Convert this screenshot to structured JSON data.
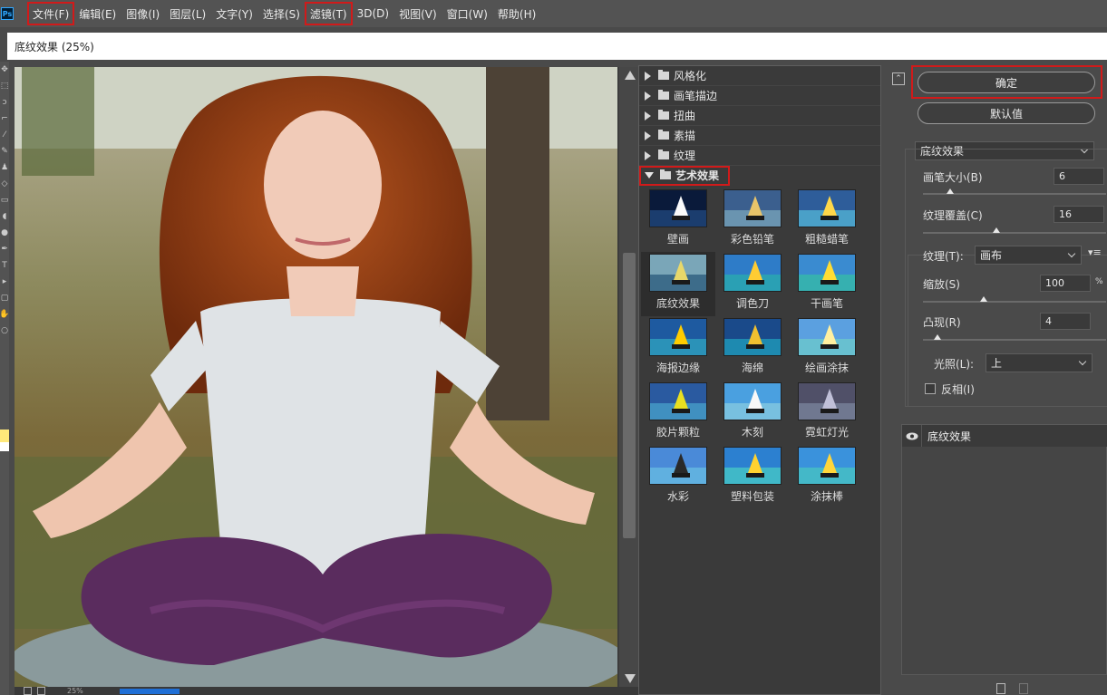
{
  "app": {
    "logo": "Ps"
  },
  "menu": [
    {
      "label": "文件(F)",
      "highlighted": true
    },
    {
      "label": "编辑(E)",
      "highlighted": false
    },
    {
      "label": "图像(I)",
      "highlighted": false
    },
    {
      "label": "图层(L)",
      "highlighted": false
    },
    {
      "label": "文字(Y)",
      "highlighted": false
    },
    {
      "label": "选择(S)",
      "highlighted": false
    },
    {
      "label": "滤镜(T)",
      "highlighted": true
    },
    {
      "label": "3D(D)",
      "highlighted": false
    },
    {
      "label": "视图(V)",
      "highlighted": false
    },
    {
      "label": "窗口(W)",
      "highlighted": false
    },
    {
      "label": "帮助(H)",
      "highlighted": false
    }
  ],
  "dialog": {
    "title": "底纹效果 (25%)"
  },
  "preview": {
    "zoom": "25%"
  },
  "gallery": {
    "categories": [
      {
        "label": "风格化",
        "expanded": false
      },
      {
        "label": "画笔描边",
        "expanded": false
      },
      {
        "label": "扭曲",
        "expanded": false
      },
      {
        "label": "素描",
        "expanded": false
      },
      {
        "label": "纹理",
        "expanded": false
      },
      {
        "label": "艺术效果",
        "expanded": true
      }
    ],
    "filters": [
      {
        "label": "壁画"
      },
      {
        "label": "彩色铅笔"
      },
      {
        "label": "粗糙蜡笔"
      },
      {
        "label": "底纹效果",
        "selected": true
      },
      {
        "label": "调色刀"
      },
      {
        "label": "干画笔"
      },
      {
        "label": "海报边缘"
      },
      {
        "label": "海绵"
      },
      {
        "label": "绘画涂抹"
      },
      {
        "label": "胶片颗粒"
      },
      {
        "label": "木刻"
      },
      {
        "label": "霓虹灯光"
      },
      {
        "label": "水彩"
      },
      {
        "label": "塑料包装"
      },
      {
        "label": "涂抹棒"
      }
    ]
  },
  "settings": {
    "ok": "确定",
    "default": "默认值",
    "filter_select": "底纹效果",
    "brush_size": {
      "label": "画笔大小(B)",
      "value": "6",
      "level": 0.15
    },
    "texture_coverage": {
      "label": "纹理覆盖(C)",
      "value": "16",
      "level": 0.4
    },
    "texture": {
      "label": "纹理(T):",
      "value": "画布"
    },
    "scaling": {
      "label": "缩放(S)",
      "value": "100",
      "unit": "%",
      "level": 0.33
    },
    "relief": {
      "label": "凸现(R)",
      "value": "4",
      "level": 0.08
    },
    "light": {
      "label": "光照(L):",
      "value": "上"
    },
    "invert": {
      "label": "反相(I)",
      "checked": false
    }
  },
  "layers": [
    {
      "label": "底纹效果",
      "visible": true
    }
  ]
}
